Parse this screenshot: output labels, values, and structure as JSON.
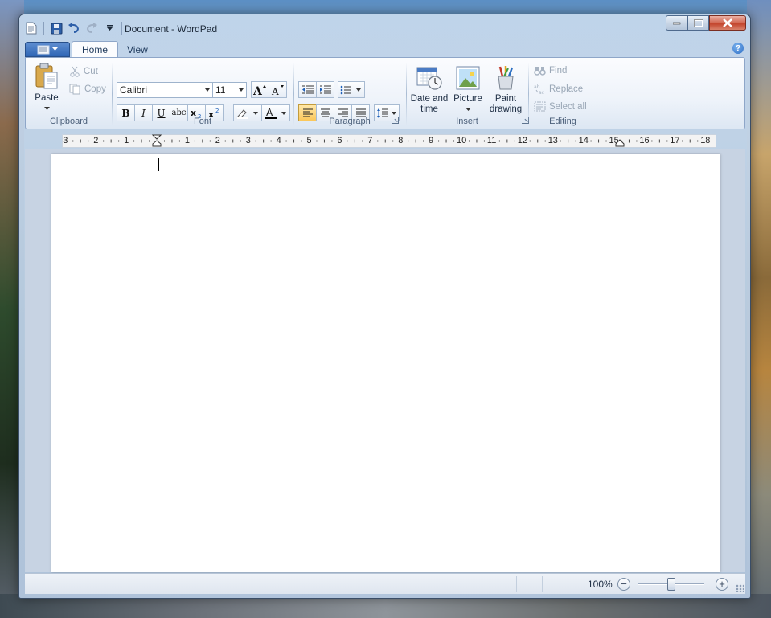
{
  "window": {
    "title": "Document - WordPad"
  },
  "tabs": [
    {
      "label": "Home",
      "active": true
    },
    {
      "label": "View",
      "active": false
    }
  ],
  "ribbon": {
    "clipboard": {
      "label": "Clipboard",
      "paste": "Paste",
      "cut": "Cut",
      "copy": "Copy"
    },
    "font": {
      "label": "Font",
      "family": "Calibri",
      "size": "11"
    },
    "paragraph": {
      "label": "Paragraph"
    },
    "insert": {
      "label": "Insert",
      "date_time_line1": "Date and",
      "date_time_line2": "time",
      "picture": "Picture",
      "paint_line1": "Paint",
      "paint_line2": "drawing"
    },
    "editing": {
      "label": "Editing",
      "find": "Find",
      "replace": "Replace",
      "select_all": "Select all"
    }
  },
  "ruler": {
    "numbers": [
      "3",
      "2",
      "1",
      "1",
      "2",
      "3",
      "4",
      "5",
      "6",
      "7",
      "8",
      "9",
      "10",
      "11",
      "12",
      "13",
      "14",
      "15",
      "16",
      "17",
      "18"
    ]
  },
  "statusbar": {
    "zoom": "100%",
    "zoom_fraction": 0.5
  },
  "icons": {
    "save": "save-icon",
    "undo": "undo-icon",
    "redo": "redo-icon",
    "help": "help-icon"
  }
}
